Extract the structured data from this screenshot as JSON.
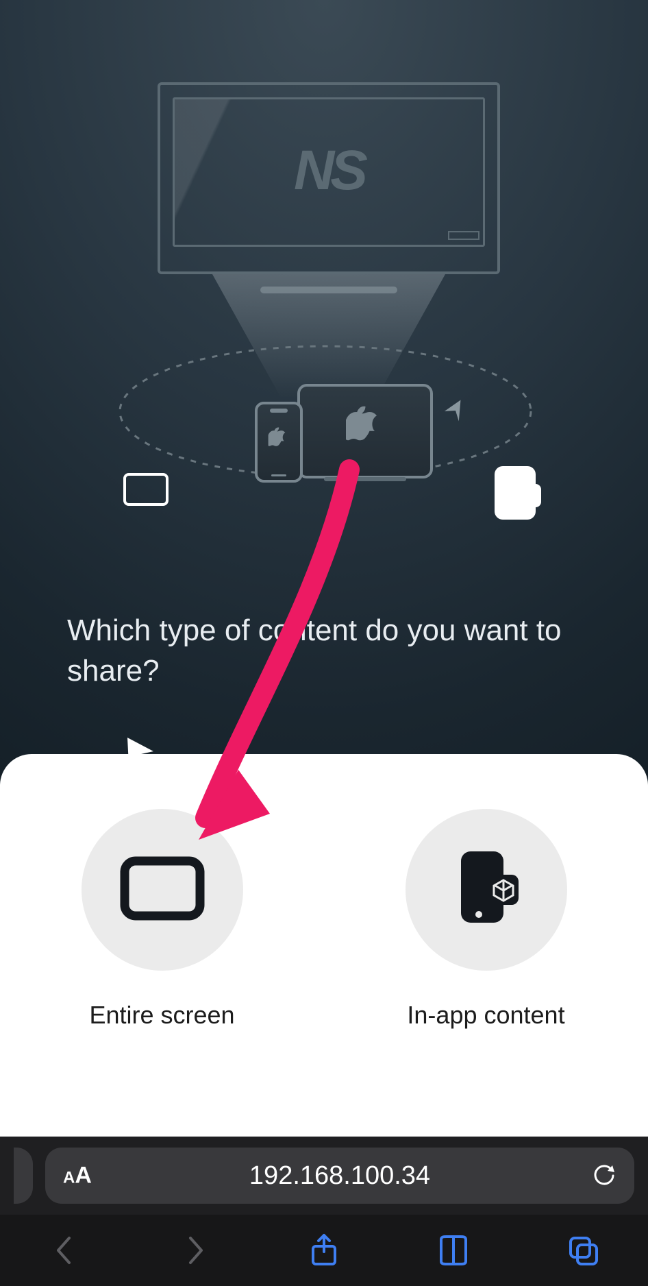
{
  "hero": {
    "logo_text": "NS",
    "prompt": "Which type of content do you want to share?"
  },
  "options": {
    "entire_screen": {
      "label": "Entire screen"
    },
    "in_app": {
      "label": "In-app content"
    }
  },
  "browser": {
    "address": "192.168.100.34"
  },
  "annotation": {
    "arrow_color": "#ed1a63"
  }
}
